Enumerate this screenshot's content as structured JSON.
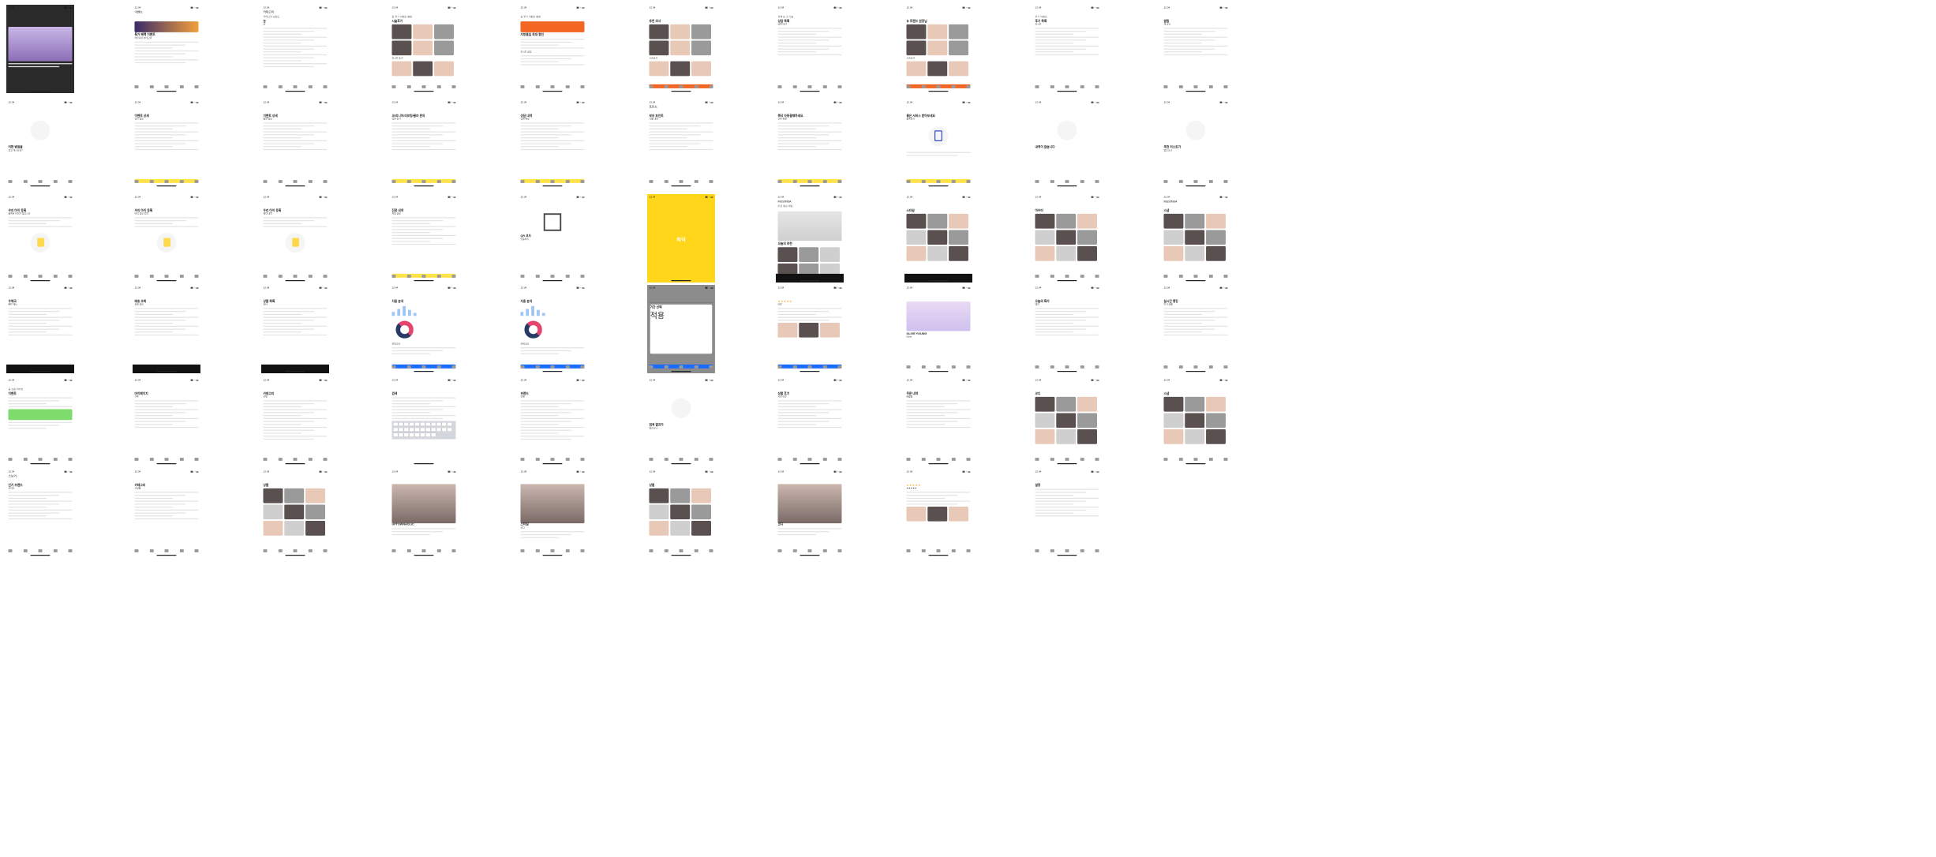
{
  "status_time": "12:34",
  "status_icons": "▮▮ ◔ ▬",
  "home_indicator": "",
  "screens": [
    {
      "header": "",
      "tabs": "",
      "text": [
        "",
        ""
      ],
      "variant": "promo-image"
    },
    {
      "header": "이벤트",
      "tabs": "",
      "text": [
        "특가 혜택 이벤트",
        "커뮤니티 카테고리"
      ],
      "variant": "event-banner"
    },
    {
      "header": "카테고리",
      "tabs": "카테고리  브랜드",
      "text": [
        "눈",
        "코",
        "가슴",
        "윤곽",
        "피부",
        "지방흡입"
      ],
      "variant": "category-grid"
    },
    {
      "header": "",
      "tabs": "홈  후기  이벤트  병원",
      "text": [
        "시술후기",
        "실시간 후기"
      ],
      "variant": "review-thumbs"
    },
    {
      "header": "",
      "tabs": "홈  후기  이벤트  병원",
      "text": [
        "지방흡입 최대 할인",
        "실시간 상담"
      ],
      "variant": "orange-banner"
    },
    {
      "header": "",
      "tabs": "",
      "text": [
        "추천 의사",
        "시술후기"
      ],
      "variant": "doctor-photos"
    },
    {
      "header": "",
      "tabs": "전체  눈  코  가슴",
      "text": [
        "상담 목록",
        "답변 대기"
      ],
      "variant": "list-plain"
    },
    {
      "header": "",
      "tabs": "",
      "text": [
        "뉴 트렌드 원장님",
        "시술후기"
      ],
      "variant": "doctor-photos-2"
    },
    {
      "header": "",
      "tabs": "후기  이벤트",
      "text": [
        "후기 목록",
        "실시간"
      ],
      "variant": "review-list"
    },
    {
      "header": "",
      "tabs": "",
      "text": [
        "알림",
        "새 소식"
      ],
      "variant": "notice-list"
    },
    {
      "header": "",
      "tabs": "",
      "text": [
        "어떤 병원을",
        "찾고 계시나요?"
      ],
      "variant": "search-empty"
    },
    {
      "header": "",
      "tabs": "",
      "text": [
        "이벤트 상세",
        "할인 정보"
      ],
      "variant": "event-detail"
    },
    {
      "header": "",
      "tabs": "",
      "text": [
        "이벤트 상세",
        "병원 정보"
      ],
      "variant": "event-photo"
    },
    {
      "header": "",
      "tabs": "",
      "text": [
        "코/리니어/리프팅/필러 문의",
        "답변 보기"
      ],
      "variant": "qna"
    },
    {
      "header": "",
      "tabs": "",
      "text": [
        "상담 내역",
        "답변 완료"
      ],
      "variant": "qna-2"
    },
    {
      "header": "포인트",
      "tabs": "",
      "text": [
        "보유 포인트",
        "사용 내역"
      ],
      "variant": "point"
    },
    {
      "header": "",
      "tabs": "",
      "text": [
        "똑닥 자동결제하세요.",
        "간편 결제"
      ],
      "variant": "pay-intro"
    },
    {
      "header": "",
      "tabs": "",
      "text": [
        "좋은 서비스 받아보세요",
        "등록하기"
      ],
      "variant": "illust-blue"
    },
    {
      "header": "",
      "tabs": "",
      "text": [
        "내역이 없습니다",
        ""
      ],
      "variant": "empty"
    },
    {
      "header": "",
      "tabs": "",
      "text": [
        "추천 리스트가",
        "없습니다"
      ],
      "variant": "empty-2"
    },
    {
      "header": "",
      "tabs": "",
      "text": [
        "우리 아이 등록",
        "등록된 아이가 없습니다"
      ],
      "variant": "kid-illust"
    },
    {
      "header": "",
      "tabs": "",
      "text": [
        "우리 아이 등록",
        "아이 정보 입력"
      ],
      "variant": "kid-illust-2"
    },
    {
      "header": "",
      "tabs": "",
      "text": [
        "우리 아이 등록",
        "예약 내역"
      ],
      "variant": "kid-illust-3"
    },
    {
      "header": "",
      "tabs": "",
      "text": [
        "진료 내역",
        "처방 정보"
      ],
      "variant": "table-yellow"
    },
    {
      "header": "",
      "tabs": "",
      "text": [
        "QR 코드",
        "인증하기"
      ],
      "variant": "qr"
    },
    {
      "header": "",
      "tabs": "",
      "text": [
        "똑닥",
        ""
      ],
      "variant": "splash"
    },
    {
      "header": "MUSINSA",
      "tabs": "추천  랭킹  세일",
      "text": [
        "오늘의 추천",
        ""
      ],
      "variant": "shoe"
    },
    {
      "header": "",
      "tabs": "",
      "text": [
        "스타일",
        "코디"
      ],
      "variant": "fashion-grid"
    },
    {
      "header": "",
      "tabs": "",
      "text": [
        "아우터",
        "가방"
      ],
      "variant": "fashion-grid-2"
    },
    {
      "header": "MUSINSA",
      "tabs": "",
      "text": [
        "스냅",
        "코디"
      ],
      "variant": "fashion-photos"
    },
    {
      "header": "",
      "tabs": "",
      "text": [
        "우체국",
        "빠른 메뉴"
      ],
      "variant": "menu-icons"
    },
    {
      "header": "",
      "tabs": "",
      "text": [
        "배송 조회",
        "상세 정보"
      ],
      "variant": "delivery"
    },
    {
      "header": "",
      "tabs": "",
      "text": [
        "상품 목록",
        "필터"
      ],
      "variant": "product-list"
    },
    {
      "header": "",
      "tabs": "",
      "text": [
        "지출 분석",
        "카테고리"
      ],
      "variant": "chart"
    },
    {
      "header": "",
      "tabs": "",
      "text": [
        "지출 분석",
        "카테고리"
      ],
      "variant": "chart-2"
    },
    {
      "header": "",
      "tabs": "",
      "text": [
        "기간 선택",
        "적용"
      ],
      "variant": "modal"
    },
    {
      "header": "",
      "tabs": "",
      "text": [
        "★★★★★",
        "리뷰"
      ],
      "variant": "rating"
    },
    {
      "header": "",
      "tabs": "",
      "text": [
        "OLIVE YOUNG",
        "Dalaf"
      ],
      "variant": "olive"
    },
    {
      "header": "",
      "tabs": "",
      "text": [
        "오늘의 특가",
        "랭킹"
      ],
      "variant": "shop-list"
    },
    {
      "header": "",
      "tabs": "",
      "text": [
        "실시간 랭킹",
        "인기 상품"
      ],
      "variant": "ranking"
    },
    {
      "header": "",
      "tabs": "홈  쇼핑  라이브",
      "text": [
        "이벤트",
        "오늘의 혜택"
      ],
      "variant": "coupon"
    },
    {
      "header": "",
      "tabs": "",
      "text": [
        "마이페이지",
        "쿠폰"
      ],
      "variant": "mypage"
    },
    {
      "header": "",
      "tabs": "",
      "text": [
        "카테고리",
        "전체"
      ],
      "variant": "category-list"
    },
    {
      "header": "",
      "tabs": "",
      "text": [
        "검색",
        ""
      ],
      "variant": "keyboard"
    },
    {
      "header": "",
      "tabs": "",
      "text": [
        "브랜드",
        "전체"
      ],
      "variant": "brand-list"
    },
    {
      "header": "",
      "tabs": "",
      "text": [
        "검색 결과가",
        "없습니다"
      ],
      "variant": "empty-3"
    },
    {
      "header": "",
      "tabs": "",
      "text": [
        "상품 후기",
        "사진 리뷰"
      ],
      "variant": "review-photos"
    },
    {
      "header": "",
      "tabs": "",
      "text": [
        "주문 내역",
        "배송중"
      ],
      "variant": "orders"
    },
    {
      "header": "",
      "tabs": "",
      "text": [
        "코디",
        "추천"
      ],
      "variant": "model-photos"
    },
    {
      "header": "",
      "tabs": "",
      "text": [
        "스냅",
        "코디"
      ],
      "variant": "model-photos-2"
    },
    {
      "header": "스토어",
      "tabs": "",
      "text": [
        "인기 브랜드",
        "라이브"
      ],
      "variant": "store"
    },
    {
      "header": "",
      "tabs": "",
      "text": [
        "카테고리",
        "신상품"
      ],
      "variant": "cat-icons"
    },
    {
      "header": "",
      "tabs": "",
      "text": [
        "상품",
        "추천"
      ],
      "variant": "product-grid"
    },
    {
      "header": "",
      "tabs": "",
      "text": [
        "UPTOWNHOLIC",
        ""
      ],
      "variant": "brand-photo"
    },
    {
      "header": "",
      "tabs": "",
      "text": [
        "스타일",
        "코디"
      ],
      "variant": "style-photo"
    },
    {
      "header": "",
      "tabs": "",
      "text": [
        "상품",
        "세일"
      ],
      "variant": "product-grid-2"
    },
    {
      "header": "",
      "tabs": "",
      "text": [
        "코디",
        ""
      ],
      "variant": "dark-photo"
    },
    {
      "header": "",
      "tabs": "",
      "text": [
        "리뷰",
        "★★★★★"
      ],
      "variant": "review-detail"
    },
    {
      "header": "",
      "tabs": "",
      "text": [
        "설정",
        ""
      ],
      "variant": "settings"
    }
  ]
}
